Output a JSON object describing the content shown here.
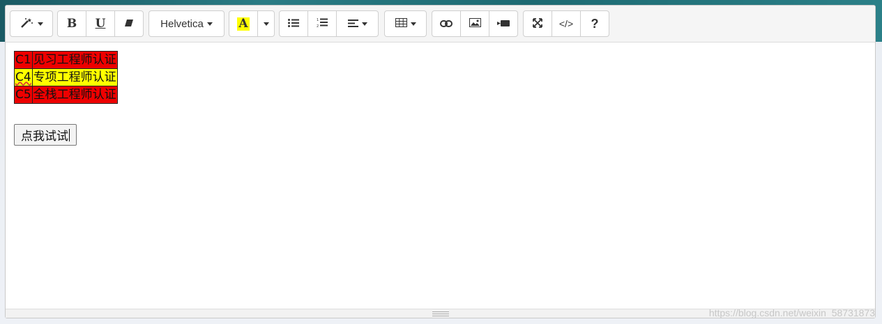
{
  "toolbar": {
    "font_name": "Helvetica",
    "color_swatch": "#ffff00",
    "icons": [
      "magic-wand-icon",
      "bold-icon",
      "underline-icon",
      "eraser-icon",
      "highlight-icon",
      "unordered-list-icon",
      "ordered-list-icon",
      "align-icon",
      "table-icon",
      "link-icon",
      "picture-icon",
      "video-icon",
      "fullscreen-icon",
      "code-view-icon",
      "help-icon"
    ],
    "bold_label": "B",
    "underline_label": "U",
    "code_label": "</>",
    "help_label": "?",
    "highlight_label": "A"
  },
  "table": {
    "rows": [
      {
        "code": "C1",
        "name": "见习工程师认证",
        "color": "#ee0000"
      },
      {
        "code": "C4",
        "name": "专项工程师认证",
        "color": "#ffff00"
      },
      {
        "code": "C5",
        "name": "全栈工程师认证",
        "color": "#ee0000"
      }
    ]
  },
  "button": {
    "label": "点我试试"
  },
  "watermark": "https://blog.csdn.net/weixin_58731873"
}
